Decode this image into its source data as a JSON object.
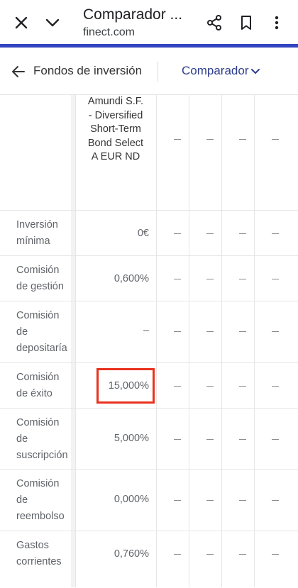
{
  "browser": {
    "title": "Comparador ...",
    "url": "finect.com",
    "accent_color": "#3344c0",
    "icons": [
      "close-icon",
      "chevron-down-icon",
      "share-icon",
      "bookmark-icon",
      "more-vert-icon"
    ]
  },
  "nav": {
    "back_label": "Fondos de inversión",
    "comparator_label": "Comparador",
    "accent_color": "#2f3e8e"
  },
  "table": {
    "fund_name": "Amundi S.F. - Diversified Short-Term Bond Select A EUR ND",
    "empty_value": "–",
    "rows": [
      {
        "label": "Inversión mínima",
        "value": "0€"
      },
      {
        "label": "Comisión de gestión",
        "value": "0,600%"
      },
      {
        "label": "Comisión de depositaría",
        "value": "–"
      },
      {
        "label": "Comisión de éxito",
        "value": "15,000%"
      },
      {
        "label": "Comisión de suscripción",
        "value": "5,000%"
      },
      {
        "label": "Comisión de reembolso",
        "value": "0,000%"
      },
      {
        "label": "Gastos corrientes",
        "value": "0,760%"
      }
    ],
    "highlight_color": "#e8321f"
  }
}
